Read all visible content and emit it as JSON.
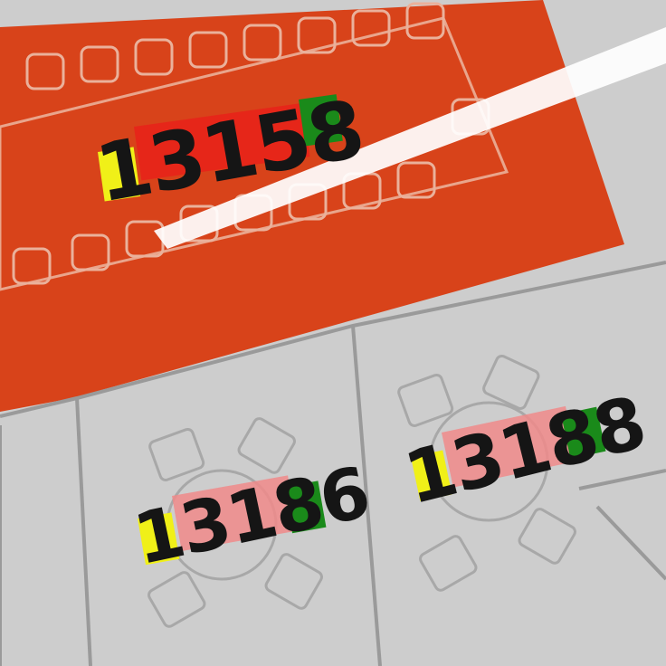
{
  "rooms": [
    {
      "id": "conference",
      "number": "13158"
    },
    {
      "id": "left-meeting",
      "number": "13186"
    },
    {
      "id": "right-meeting",
      "number": "13188"
    }
  ],
  "colors": {
    "room_fill": "#d8431a",
    "highlight_yellow": "#f0f018",
    "highlight_red": "#e8241a",
    "highlight_pink": "#f08a8a",
    "highlight_green": "#1a8a1a",
    "wall_line": "#9a9a9a",
    "glare": "#ffffff"
  }
}
